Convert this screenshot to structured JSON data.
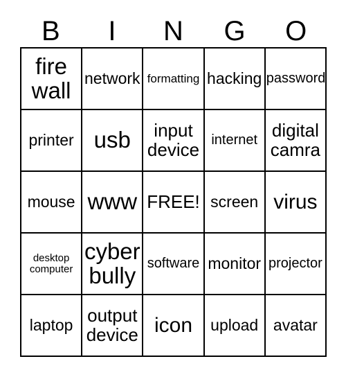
{
  "card": {
    "title": "BINGO",
    "header_letters": [
      "B",
      "I",
      "N",
      "G",
      "O"
    ],
    "grid_size": "5x5",
    "free_space": "FREE!",
    "colors": {
      "text": "#000000",
      "background": "#ffffff",
      "border": "#000000"
    },
    "rows": [
      [
        {
          "text": "fire\nwall",
          "size": "fs-xxl"
        },
        {
          "text": "network",
          "size": "fs-md"
        },
        {
          "text": "formatting",
          "size": "fs-xs"
        },
        {
          "text": "hacking",
          "size": "fs-md"
        },
        {
          "text": "password",
          "size": "fs-sm"
        }
      ],
      [
        {
          "text": "printer",
          "size": "fs-md"
        },
        {
          "text": "usb",
          "size": "fs-xxl"
        },
        {
          "text": "input\ndevice",
          "size": "fs-lg"
        },
        {
          "text": "internet",
          "size": "fs-sm"
        },
        {
          "text": "digital\ncamra",
          "size": "fs-lg"
        }
      ],
      [
        {
          "text": "mouse",
          "size": "fs-md"
        },
        {
          "text": "www",
          "size": "fs-xxl"
        },
        {
          "text": "FREE!",
          "size": "fs-lg"
        },
        {
          "text": "screen",
          "size": "fs-md"
        },
        {
          "text": "virus",
          "size": "fs-xl"
        }
      ],
      [
        {
          "text": "desktop\ncomputer",
          "size": "fs-xxs"
        },
        {
          "text": "cyber\nbully",
          "size": "fs-xxl"
        },
        {
          "text": "software",
          "size": "fs-sm"
        },
        {
          "text": "monitor",
          "size": "fs-md"
        },
        {
          "text": "projector",
          "size": "fs-sm"
        }
      ],
      [
        {
          "text": "laptop",
          "size": "fs-md"
        },
        {
          "text": "output\ndevice",
          "size": "fs-lg"
        },
        {
          "text": "icon",
          "size": "fs-xl"
        },
        {
          "text": "upload",
          "size": "fs-md"
        },
        {
          "text": "avatar",
          "size": "fs-md"
        }
      ]
    ]
  }
}
